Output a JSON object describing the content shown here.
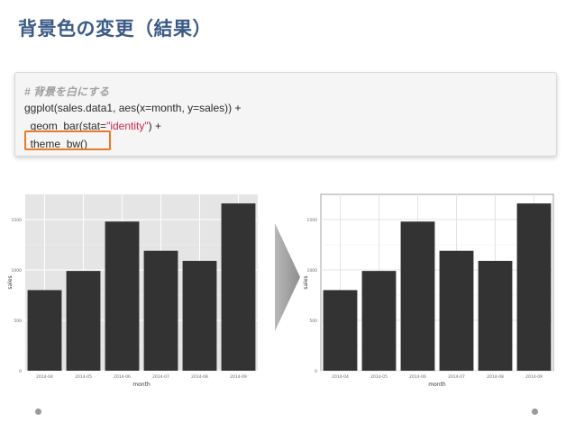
{
  "slide": {
    "title": "背景色の変更（結果）"
  },
  "code": {
    "comment": "# 背景を白にする",
    "line1": "ggplot(sales.data1, aes(x=month, y=sales)) +",
    "line2_prefix": "  geom_bar(stat=",
    "line2_string": "\"identity\"",
    "line2_suffix": ") +",
    "line3": "  theme_bw()"
  },
  "colors": {
    "title": "#3b5b86",
    "highlight_border": "#e87a28",
    "bar_fill": "#333333",
    "grey_panel": "#e5e5e5",
    "code_string": "#d0264b"
  },
  "chart_data": [
    {
      "type": "bar",
      "theme": "ggplot2 default (grey background)",
      "categories": [
        "2014-04",
        "2014-05",
        "2014-06",
        "2014-07",
        "2014-08",
        "2014-09"
      ],
      "values": [
        800,
        990,
        1480,
        1190,
        1090,
        1660
      ],
      "xlabel": "month",
      "ylabel": "sales",
      "yticks": [
        "0",
        "500",
        "1000",
        "1500"
      ],
      "ylim": [
        0,
        1750
      ],
      "grid": true
    },
    {
      "type": "bar",
      "theme": "theme_bw (white background)",
      "categories": [
        "2014-04",
        "2014-05",
        "2014-06",
        "2014-07",
        "2014-08",
        "2014-09"
      ],
      "values": [
        800,
        990,
        1480,
        1190,
        1090,
        1660
      ],
      "xlabel": "month",
      "ylabel": "sales",
      "yticks": [
        "0",
        "500",
        "1000",
        "1500"
      ],
      "ylim": [
        0,
        1750
      ],
      "grid": true
    }
  ],
  "navigation": {
    "arrow_icon": "chevron-right-arrow-icon",
    "left_dot": "pager-dot",
    "right_dot": "pager-dot"
  }
}
